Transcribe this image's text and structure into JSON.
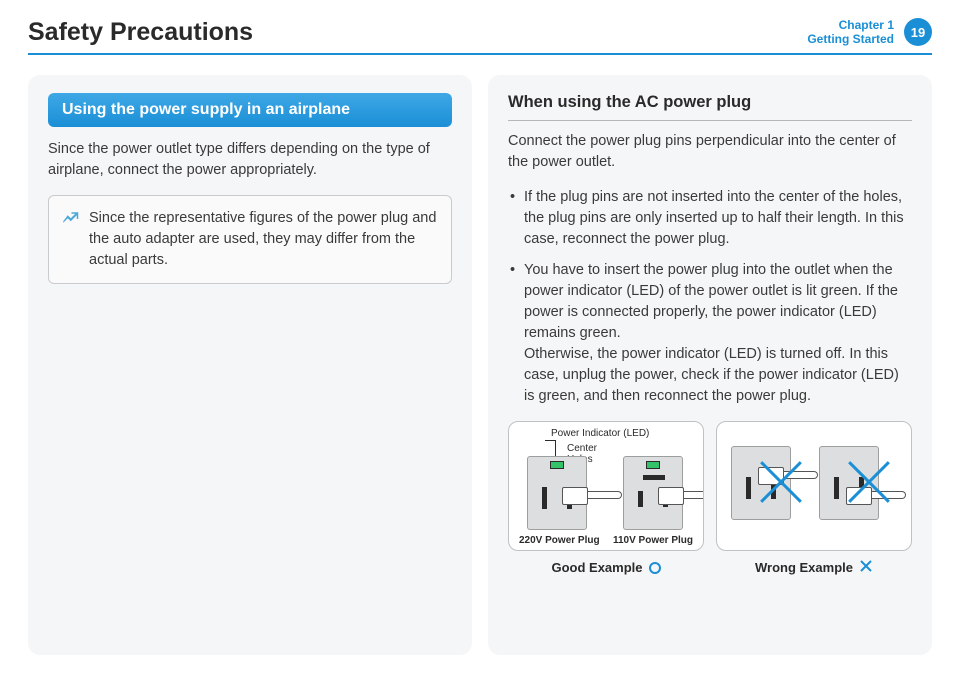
{
  "header": {
    "title": "Safety Precautions",
    "chapter_number": "Chapter 1",
    "chapter_name": "Getting Started",
    "page_number": "19"
  },
  "left": {
    "section_title": "Using the power supply in an airplane",
    "intro": "Since the power outlet type differs depending on the type of airplane, connect the power appropriately.",
    "note": "Since the representative figures of the power plug and the auto adapter are used, they may differ from the actual parts."
  },
  "right": {
    "subheading": "When using the AC power plug",
    "intro": "Connect the power plug pins perpendicular into the center of the power outlet.",
    "bullets": [
      "If the plug pins are not inserted into the center of the holes, the plug pins are only inserted up to half their length. In this case, reconnect the power plug.",
      "You have to insert the power plug into the outlet when the power indicator (LED) of the power outlet is lit green. If the power is connected properly, the power indicator (LED) remains green.\nOtherwise, the power indicator (LED) is turned off. In this case, unplug the power, check if the power indicator (LED) is green, and then reconnect the power plug."
    ],
    "diagram": {
      "annot_led": "Power Indicator (LED)",
      "annot_center": "Center Holes",
      "label_220": "220V Power Plug",
      "label_110": "110V Power Plug",
      "good_caption": "Good Example",
      "wrong_caption": "Wrong Example"
    }
  }
}
